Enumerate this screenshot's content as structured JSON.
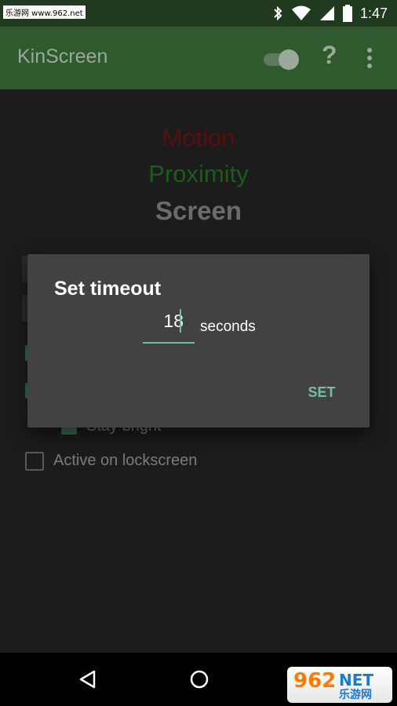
{
  "status_bar": {
    "watermark": "乐游网 www.962.net",
    "time": "1:47",
    "icons": [
      "bluetooth-icon",
      "wifi-icon",
      "signal-icon",
      "battery-icon"
    ]
  },
  "app_bar": {
    "title": "KinScreen",
    "help_label": "?",
    "toggle_on": true
  },
  "content": {
    "line1": "Motion",
    "line2": "Proximity",
    "line3": "Screen",
    "rows": [
      {
        "label": "Stay bright",
        "checked": true
      },
      {
        "label": "Active on lockscreen",
        "checked": false
      }
    ]
  },
  "dialog": {
    "title": "Set timeout",
    "value": "18",
    "unit": "seconds",
    "button": "SET"
  },
  "nav": {
    "back": "back-icon",
    "home": "home-icon"
  },
  "logo": {
    "number": "962",
    "net": "NET",
    "cn": "乐游网"
  },
  "colors": {
    "appbar": "#2e5a2e",
    "accent": "#6fc0a4",
    "dialog": "#424242"
  }
}
